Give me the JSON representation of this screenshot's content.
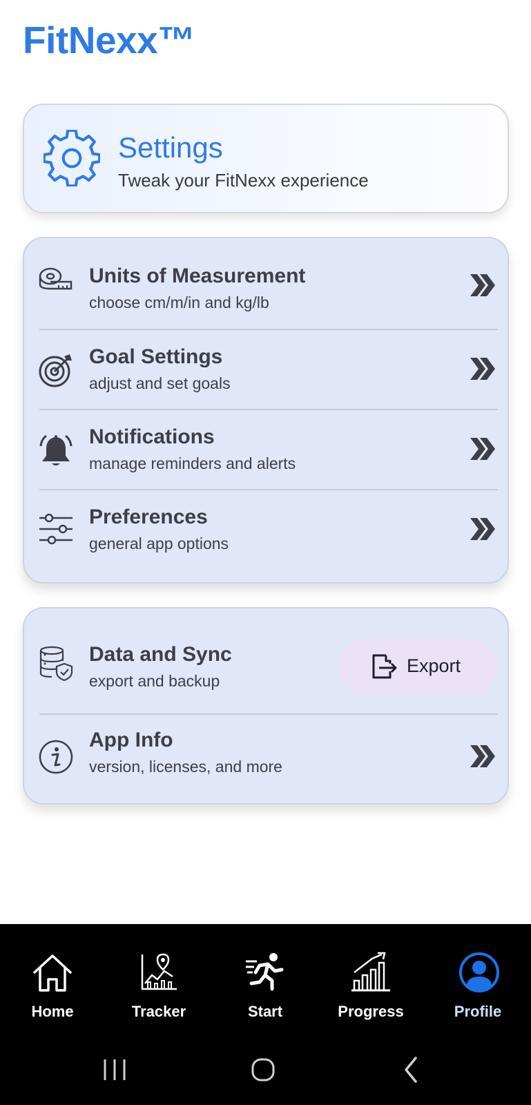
{
  "app": {
    "brand": "FitNexx™"
  },
  "header": {
    "title": "Settings",
    "subtitle": "Tweak your FitNexx experience",
    "icon": "gear-icon"
  },
  "settings": [
    {
      "title": "Units of Measurement",
      "subtitle": "choose cm/m/in and kg/lb",
      "icon": "tape-measure-icon"
    },
    {
      "title": "Goal Settings",
      "subtitle": "adjust and set goals",
      "icon": "target-icon"
    },
    {
      "title": "Notifications",
      "subtitle": "manage reminders and alerts",
      "icon": "bell-icon"
    },
    {
      "title": "Preferences",
      "subtitle": "general app options",
      "icon": "sliders-icon"
    }
  ],
  "data_section": {
    "data_sync": {
      "title": "Data and Sync",
      "subtitle": "export and backup",
      "icon": "database-shield-icon"
    },
    "export_button": {
      "label": "Export",
      "icon": "export-icon"
    },
    "app_info": {
      "title": "App Info",
      "subtitle": "version, licenses, and more",
      "icon": "info-icon"
    }
  },
  "nav": [
    {
      "label": "Home",
      "icon": "home-icon"
    },
    {
      "label": "Tracker",
      "icon": "tracker-icon"
    },
    {
      "label": "Start",
      "icon": "running-icon"
    },
    {
      "label": "Progress",
      "icon": "progress-chart-icon"
    },
    {
      "label": "Profile",
      "icon": "profile-icon",
      "active": true
    }
  ],
  "colors": {
    "brand": "#2f7be6",
    "card_bg": "#dfe7f9",
    "export_bg": "#ebe2f7",
    "nav_bg": "#000000"
  }
}
